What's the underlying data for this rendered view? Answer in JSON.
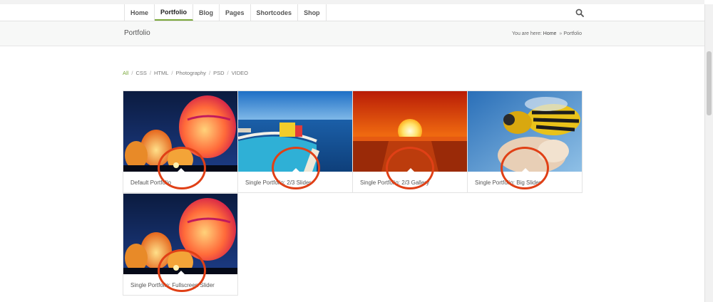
{
  "nav": {
    "items": [
      {
        "label": "Home"
      },
      {
        "label": "Portfolio",
        "active": true
      },
      {
        "label": "Blog"
      },
      {
        "label": "Pages"
      },
      {
        "label": "Shortcodes"
      },
      {
        "label": "Shop"
      }
    ],
    "search_icon": "search-icon"
  },
  "titlebar": {
    "title": "Portfolio",
    "breadcrumb_prefix": "You are here:",
    "breadcrumb_home": "Home",
    "breadcrumb_sep": "»",
    "breadcrumb_current": "Portfolio"
  },
  "filters": {
    "separator": "/",
    "items": [
      {
        "label": "All",
        "active": true
      },
      {
        "label": "CSS"
      },
      {
        "label": "HTML"
      },
      {
        "label": "Photography"
      },
      {
        "label": "PSD"
      },
      {
        "label": "VIDEO"
      }
    ]
  },
  "portfolio": {
    "items": [
      {
        "caption": "Default Portfolio",
        "image": "hot-air-balloons"
      },
      {
        "caption": "Single Portfolio: 2/3 Slider",
        "image": "pool-ocean"
      },
      {
        "caption": "Single Portfolio: 2/3 Gallery",
        "image": "sunset"
      },
      {
        "caption": "Single Portfolio: Big Slider",
        "image": "wasp"
      },
      {
        "caption": "Single Portfolio: Fullscreen Slider",
        "image": "hot-air-balloons"
      }
    ]
  },
  "colors": {
    "accent": "#7aa83b",
    "annotation_circle": "#e04016"
  }
}
